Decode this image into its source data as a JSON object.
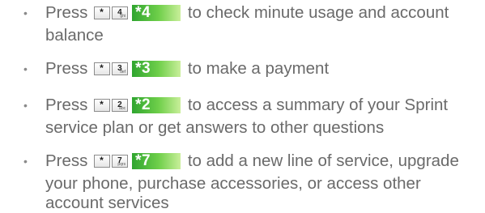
{
  "items": [
    {
      "prefix": "Press",
      "star_key": "*",
      "digit_key": "4",
      "digit_letters": "ghi",
      "code": "*4",
      "text": "to check minute usage and account balance"
    },
    {
      "prefix": "Press",
      "star_key": "*",
      "digit_key": "3",
      "digit_letters": "def",
      "code": "*3",
      "text": "to make a payment"
    },
    {
      "prefix": "Press",
      "star_key": "*",
      "digit_key": "2",
      "digit_letters": "abc",
      "code": "*2",
      "text": "to access a summary of your Sprint service plan or get answers to other questions"
    },
    {
      "prefix": "Press",
      "star_key": "*",
      "digit_key": "7",
      "digit_letters": "pqrs",
      "code": "*7",
      "text": "to add a new line of service, upgrade your phone, purchase accessories, or access other account services"
    }
  ],
  "colors": {
    "text": "#6a6a6a",
    "code_gradient_start": "#2fa52f",
    "code_gradient_end": "#c9ef9a"
  }
}
